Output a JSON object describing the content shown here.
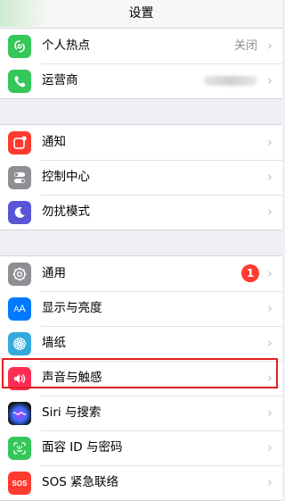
{
  "navbar": {
    "title": "设置"
  },
  "groups": [
    {
      "items": [
        {
          "label": "个人热点",
          "detail": "关闭",
          "icon": "personal-hotspot-icon",
          "color": "#34c759"
        },
        {
          "label": "运营商",
          "detail": "",
          "icon": "carrier-phone-icon",
          "color": "#34c759"
        }
      ]
    },
    {
      "items": [
        {
          "label": "通知",
          "icon": "notifications-icon",
          "color": "#ff3b30"
        },
        {
          "label": "控制中心",
          "icon": "control-center-icon",
          "color": "#8e8e93"
        },
        {
          "label": "勿扰模式",
          "icon": "moon-icon",
          "color": "#5856d6"
        }
      ]
    },
    {
      "items": [
        {
          "label": "通用",
          "badge": "1",
          "icon": "gear-icon",
          "color": "#8e8e93"
        },
        {
          "label": "显示与亮度",
          "icon": "display-aa-icon",
          "color": "#007aff"
        },
        {
          "label": "墙纸",
          "icon": "wallpaper-flower-icon",
          "color": "#34aadc"
        },
        {
          "label": "声音与触感",
          "icon": "speaker-icon",
          "color": "#ff2d55",
          "highlighted": true
        },
        {
          "label": "Siri 与搜索",
          "icon": "siri-icon",
          "color": "#1c1c1e"
        },
        {
          "label": "面容 ID 与密码",
          "icon": "face-id-icon",
          "color": "#34c759"
        },
        {
          "label": "SOS 紧急联络",
          "icon": "sos-icon",
          "color": "#ff3b30"
        }
      ]
    }
  ],
  "colors": {
    "highlight": "#e02020",
    "background": "#efeff4"
  }
}
